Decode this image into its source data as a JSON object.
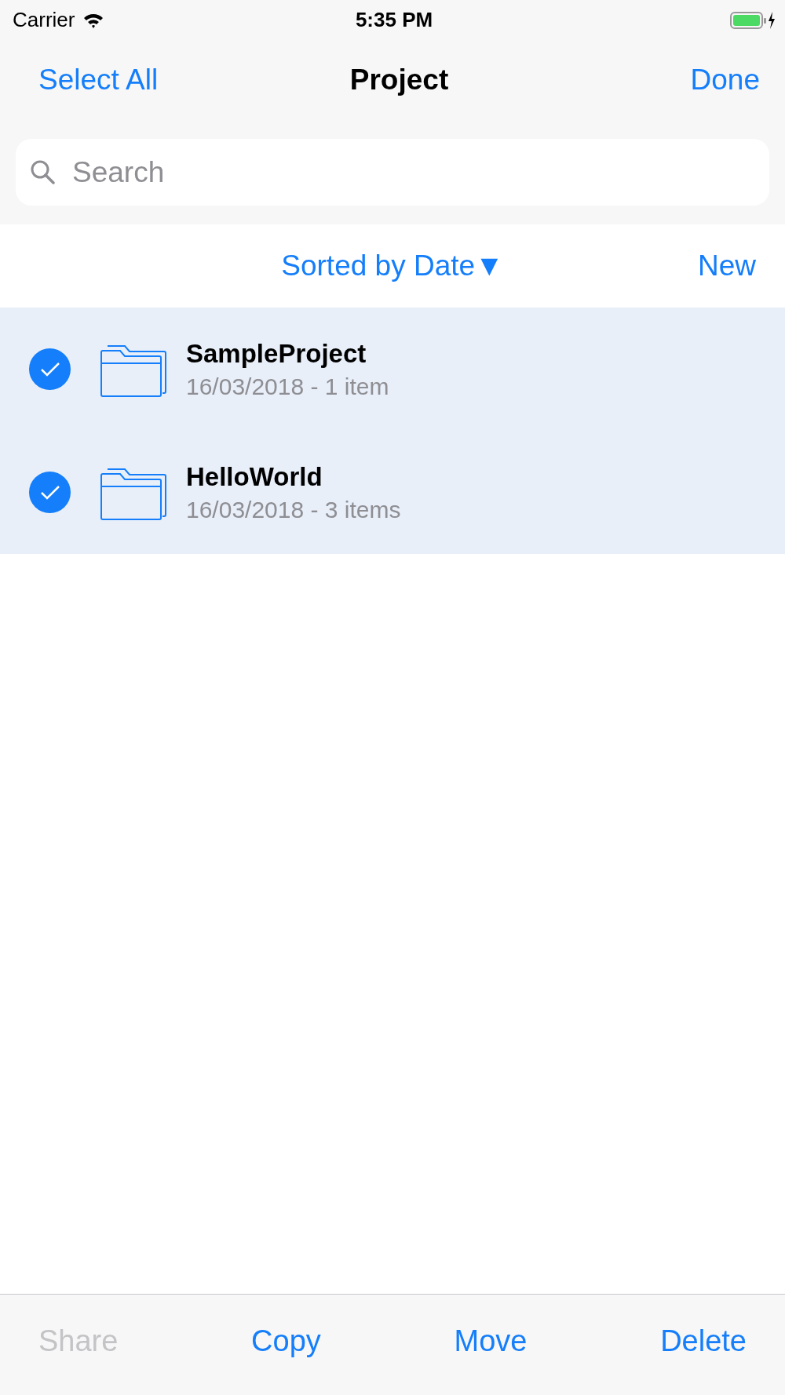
{
  "status_bar": {
    "carrier": "Carrier",
    "time": "5:35 PM"
  },
  "nav_bar": {
    "left": "Select All",
    "title": "Project",
    "right": "Done"
  },
  "search": {
    "placeholder": "Search"
  },
  "sort_bar": {
    "sort": "Sorted by Date▼",
    "new": "New"
  },
  "rows": [
    {
      "name": "SampleProject",
      "detail": "16/03/2018 - 1 item",
      "selected": true
    },
    {
      "name": "HelloWorld",
      "detail": "16/03/2018 - 3 items",
      "selected": true
    }
  ],
  "toolbar": [
    {
      "label": "Share",
      "disabled": true
    },
    {
      "label": "Copy",
      "disabled": false
    },
    {
      "label": "Move",
      "disabled": false
    },
    {
      "label": "Delete",
      "disabled": false
    }
  ]
}
